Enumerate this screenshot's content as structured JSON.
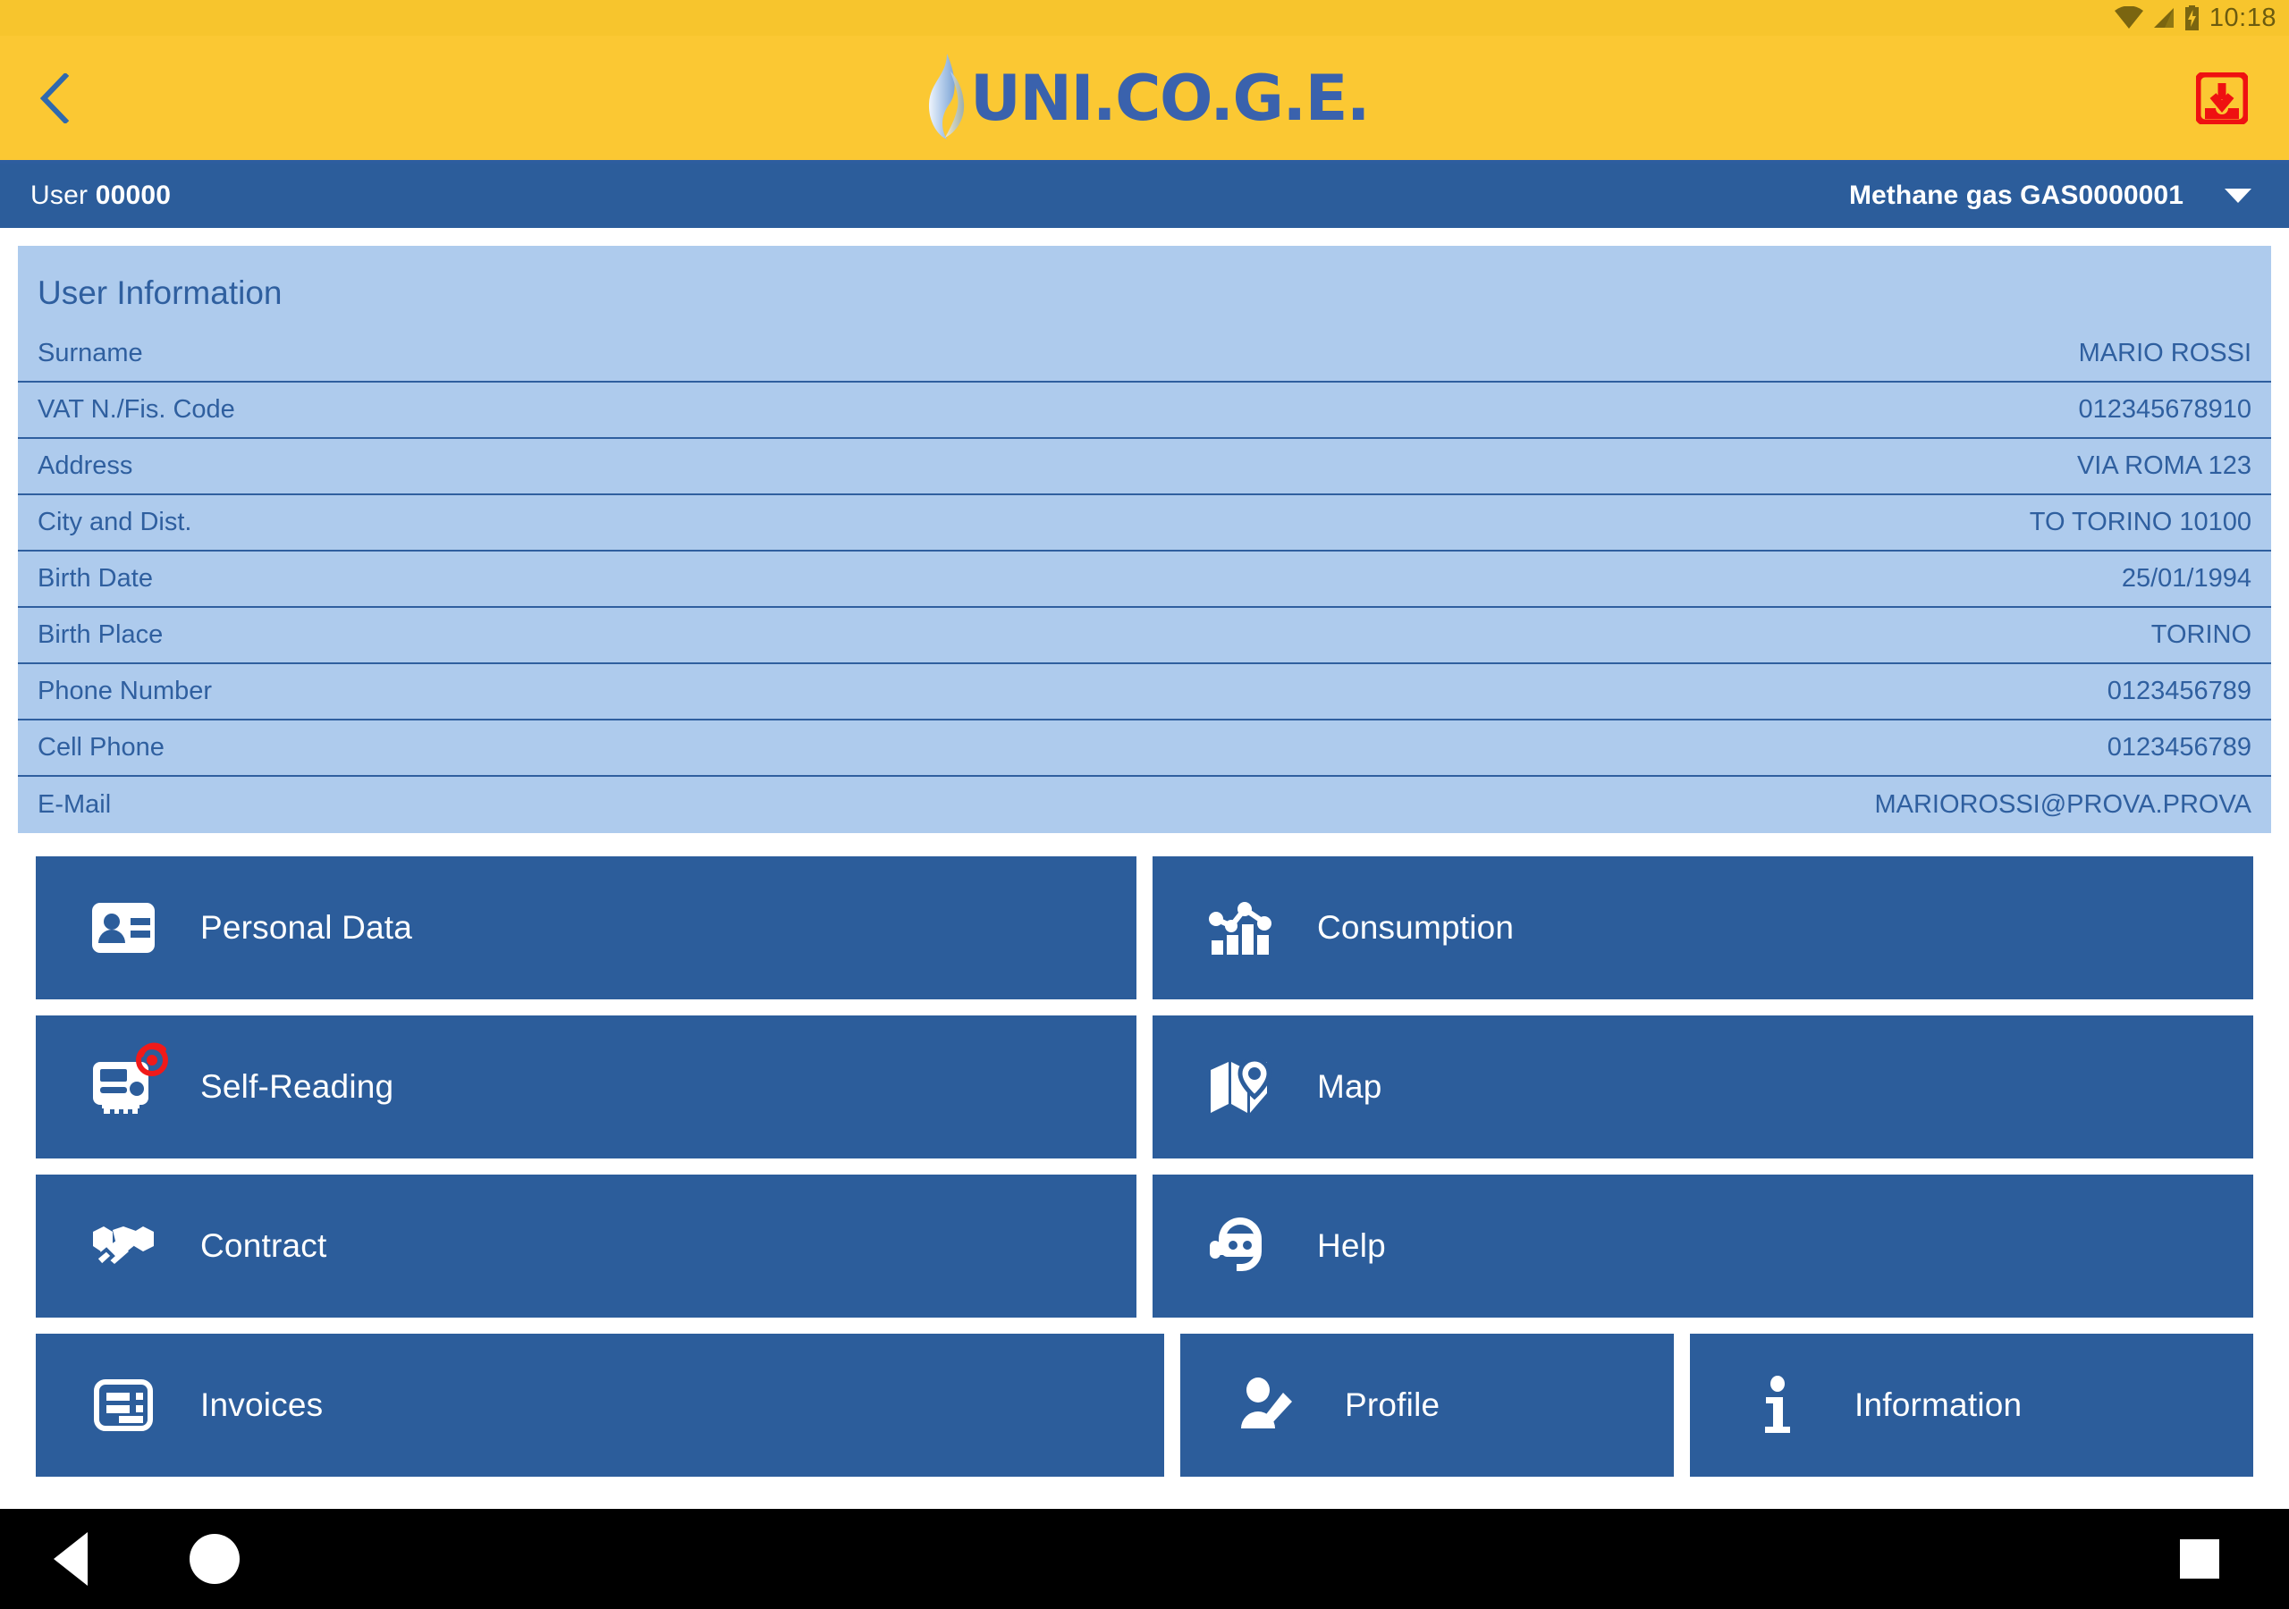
{
  "status_bar": {
    "time": "10:18",
    "icons": [
      "wifi-icon",
      "cellular-signal-icon",
      "battery-charging-icon"
    ]
  },
  "header": {
    "back_icon": "chevron-left-icon",
    "logo_text": "UNI.CO.G.E.",
    "logo_flame_icon": "gas-flame-icon",
    "download_icon": "download-inbox-icon",
    "background_color": "#fbc833",
    "logo_color": "#3a62ad",
    "download_color": "#ef1111"
  },
  "user_bar": {
    "user_label": "User",
    "user_id": "00000",
    "meter_selected": "Methane gas GAS0000001",
    "dropdown_icon": "chevron-down-icon",
    "background_color": "#2c5d9b"
  },
  "user_information": {
    "title": "User Information",
    "card_color": "#aecbed",
    "text_color": "#2f5f9f",
    "rows": [
      {
        "label": "Surname",
        "value": "MARIO ROSSI"
      },
      {
        "label": "VAT N./Fis. Code",
        "value": "012345678910"
      },
      {
        "label": "Address",
        "value": "VIA ROMA 123"
      },
      {
        "label": "City and Dist.",
        "value": "TO TORINO 10100"
      },
      {
        "label": "Birth Date",
        "value": "25/01/1994"
      },
      {
        "label": "Birth Place",
        "value": "TORINO"
      },
      {
        "label": "Phone Number",
        "value": "0123456789"
      },
      {
        "label": "Cell Phone",
        "value": "0123456789"
      },
      {
        "label": "E-Mail",
        "value": "MARIOROSSI@PROVA.PROVA"
      }
    ]
  },
  "tiles": {
    "tile_color": "#2c5d9b",
    "badge_color": "#f01a1a",
    "items": [
      {
        "label": "Personal Data",
        "icon": "contact-card-icon",
        "badge": false
      },
      {
        "label": "Consumption",
        "icon": "bar-chart-icon",
        "badge": false
      },
      {
        "label": "Self-Reading",
        "icon": "gas-meter-icon",
        "badge": true
      },
      {
        "label": "Map",
        "icon": "map-pin-icon",
        "badge": false
      },
      {
        "label": "Contract",
        "icon": "handshake-icon",
        "badge": false
      },
      {
        "label": "Help",
        "icon": "headset-support-icon",
        "badge": false
      },
      {
        "label": "Invoices",
        "icon": "invoice-icon",
        "badge": false
      },
      {
        "label": "Profile",
        "icon": "person-edit-icon",
        "badge": false
      },
      {
        "label": "Information",
        "icon": "info-icon",
        "badge": false
      }
    ]
  },
  "nav_bar": {
    "back_icon": "android-back-icon",
    "home_icon": "android-home-icon",
    "recents_icon": "android-recents-icon",
    "background_color": "#000000"
  }
}
